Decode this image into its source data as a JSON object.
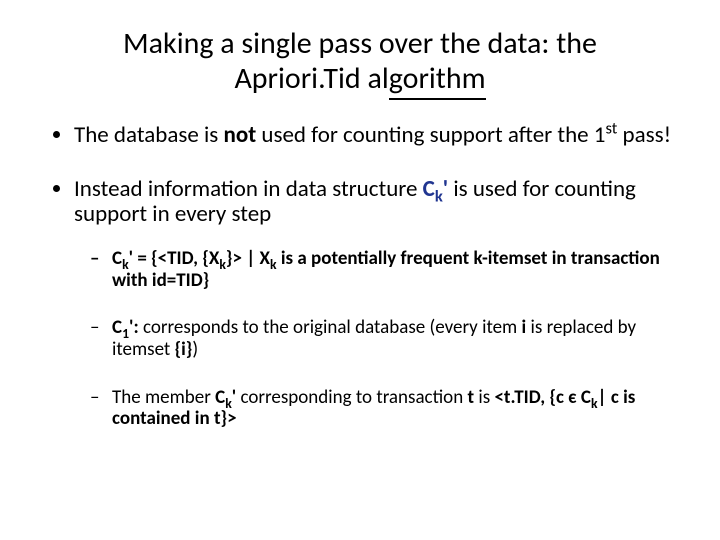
{
  "title": {
    "line1": "Making a single pass over the data: the",
    "line2_pre": "Apriori.Tid al",
    "line2_uline": "gorithm"
  },
  "b1": {
    "t1": "The database is ",
    "not": "not",
    "t2": " used  for counting support after the 1",
    "st": "st",
    "t3": " pass!"
  },
  "b2": {
    "t1": "Instead information in data structure ",
    "Ck": "C",
    "k": "k",
    "prime": "'",
    "t2": " is used for counting support in every step"
  },
  "s1": {
    "Ck": "C",
    "k": "k",
    "prime": "'",
    "eq": " = {<TID, {X",
    "xk": "k",
    "mid": "}> | X",
    "xk2": "k",
    "rest": " is a potentially frequent k-itemset in transaction with id=TID}"
  },
  "s2": {
    "C1": "C",
    "one": "1",
    "prime": "'",
    "colon": ": ",
    "t1": "corresponds to the original database (every item ",
    "i": "i",
    "t2": " is replaced by itemset ",
    "set": "{i}",
    "t3": ")"
  },
  "s3": {
    "t1": "The member ",
    "Ck": "C",
    "k": "k",
    "prime": "'",
    "t2": " corresponding to transaction ",
    "tvar": "t",
    "t3": " is ",
    "tTID": "<t.TID, {c є C",
    "k2": "k",
    "bar": "|",
    "rest": " c is contained in t}>"
  }
}
